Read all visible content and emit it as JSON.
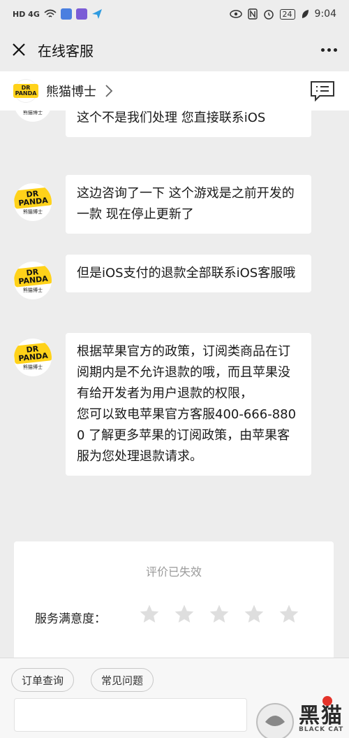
{
  "status_bar": {
    "network": "HD 4G",
    "battery": "24",
    "time": "9:04"
  },
  "header": {
    "title": "在线客服"
  },
  "store": {
    "name": "熊猫博士",
    "logo_text": "DR PANDA"
  },
  "avatar": {
    "logo_text": "DR PANDA",
    "caption": "熊猫博士"
  },
  "messages": [
    {
      "text": "这个不是我们处理 您直接联系iOS"
    },
    {
      "text": "这边咨询了一下 这个游戏是之前开发的一款 现在停止更新了"
    },
    {
      "text": "但是iOS支付的退款全部联系iOS客服哦"
    },
    {
      "text": "根据苹果官方的政策，订阅类商品在订阅期内是不允许退款的哦，而且苹果没有给开发者为用户退款的权限，\n您可以致电苹果官方客服400-666-8800 了解更多苹果的订阅政策，由苹果客服为您处理退款请求。"
    }
  ],
  "rating": {
    "status": "评价已失效",
    "label": "服务满意度：",
    "stars_total": 5,
    "stars_selected": 0
  },
  "quick_actions": {
    "order_query": "订单查询",
    "faq": "常见问题"
  },
  "watermark": {
    "text": "黑猫",
    "sub": "BLACK CAT"
  },
  "colors": {
    "background": "#ededed",
    "bubble": "#ffffff",
    "logo_yellow": "#ffd21a",
    "muted_text": "#9a9a9a",
    "star_grey": "#dedede"
  }
}
